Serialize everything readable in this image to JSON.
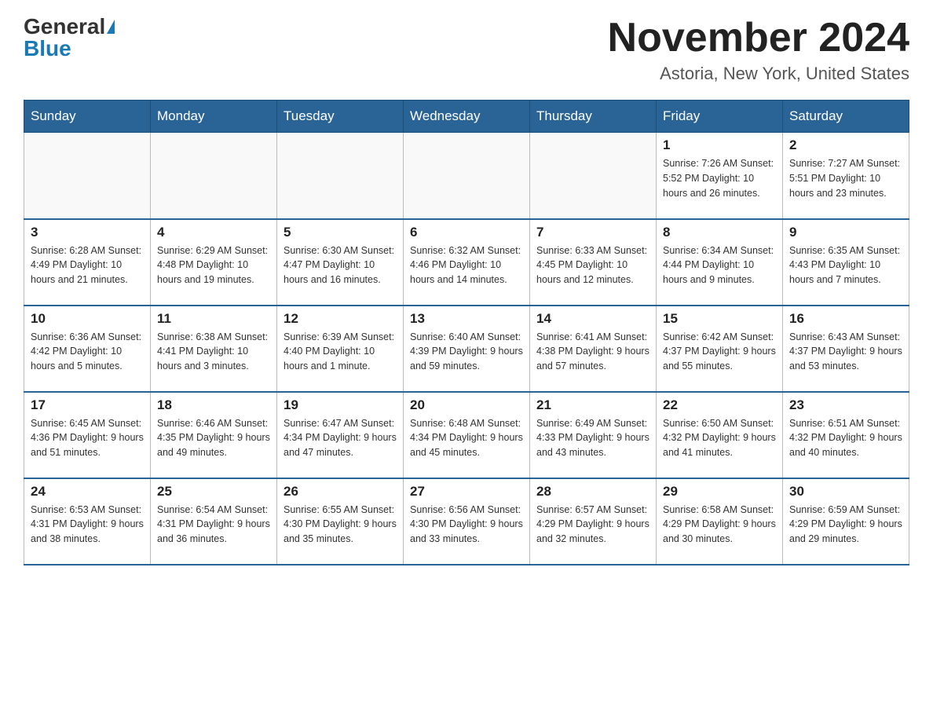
{
  "header": {
    "logo_general": "General",
    "logo_blue": "Blue",
    "main_title": "November 2024",
    "subtitle": "Astoria, New York, United States"
  },
  "days_of_week": [
    "Sunday",
    "Monday",
    "Tuesday",
    "Wednesday",
    "Thursday",
    "Friday",
    "Saturday"
  ],
  "weeks": [
    [
      {
        "day": "",
        "info": ""
      },
      {
        "day": "",
        "info": ""
      },
      {
        "day": "",
        "info": ""
      },
      {
        "day": "",
        "info": ""
      },
      {
        "day": "",
        "info": ""
      },
      {
        "day": "1",
        "info": "Sunrise: 7:26 AM\nSunset: 5:52 PM\nDaylight: 10 hours and 26 minutes."
      },
      {
        "day": "2",
        "info": "Sunrise: 7:27 AM\nSunset: 5:51 PM\nDaylight: 10 hours and 23 minutes."
      }
    ],
    [
      {
        "day": "3",
        "info": "Sunrise: 6:28 AM\nSunset: 4:49 PM\nDaylight: 10 hours and 21 minutes."
      },
      {
        "day": "4",
        "info": "Sunrise: 6:29 AM\nSunset: 4:48 PM\nDaylight: 10 hours and 19 minutes."
      },
      {
        "day": "5",
        "info": "Sunrise: 6:30 AM\nSunset: 4:47 PM\nDaylight: 10 hours and 16 minutes."
      },
      {
        "day": "6",
        "info": "Sunrise: 6:32 AM\nSunset: 4:46 PM\nDaylight: 10 hours and 14 minutes."
      },
      {
        "day": "7",
        "info": "Sunrise: 6:33 AM\nSunset: 4:45 PM\nDaylight: 10 hours and 12 minutes."
      },
      {
        "day": "8",
        "info": "Sunrise: 6:34 AM\nSunset: 4:44 PM\nDaylight: 10 hours and 9 minutes."
      },
      {
        "day": "9",
        "info": "Sunrise: 6:35 AM\nSunset: 4:43 PM\nDaylight: 10 hours and 7 minutes."
      }
    ],
    [
      {
        "day": "10",
        "info": "Sunrise: 6:36 AM\nSunset: 4:42 PM\nDaylight: 10 hours and 5 minutes."
      },
      {
        "day": "11",
        "info": "Sunrise: 6:38 AM\nSunset: 4:41 PM\nDaylight: 10 hours and 3 minutes."
      },
      {
        "day": "12",
        "info": "Sunrise: 6:39 AM\nSunset: 4:40 PM\nDaylight: 10 hours and 1 minute."
      },
      {
        "day": "13",
        "info": "Sunrise: 6:40 AM\nSunset: 4:39 PM\nDaylight: 9 hours and 59 minutes."
      },
      {
        "day": "14",
        "info": "Sunrise: 6:41 AM\nSunset: 4:38 PM\nDaylight: 9 hours and 57 minutes."
      },
      {
        "day": "15",
        "info": "Sunrise: 6:42 AM\nSunset: 4:37 PM\nDaylight: 9 hours and 55 minutes."
      },
      {
        "day": "16",
        "info": "Sunrise: 6:43 AM\nSunset: 4:37 PM\nDaylight: 9 hours and 53 minutes."
      }
    ],
    [
      {
        "day": "17",
        "info": "Sunrise: 6:45 AM\nSunset: 4:36 PM\nDaylight: 9 hours and 51 minutes."
      },
      {
        "day": "18",
        "info": "Sunrise: 6:46 AM\nSunset: 4:35 PM\nDaylight: 9 hours and 49 minutes."
      },
      {
        "day": "19",
        "info": "Sunrise: 6:47 AM\nSunset: 4:34 PM\nDaylight: 9 hours and 47 minutes."
      },
      {
        "day": "20",
        "info": "Sunrise: 6:48 AM\nSunset: 4:34 PM\nDaylight: 9 hours and 45 minutes."
      },
      {
        "day": "21",
        "info": "Sunrise: 6:49 AM\nSunset: 4:33 PM\nDaylight: 9 hours and 43 minutes."
      },
      {
        "day": "22",
        "info": "Sunrise: 6:50 AM\nSunset: 4:32 PM\nDaylight: 9 hours and 41 minutes."
      },
      {
        "day": "23",
        "info": "Sunrise: 6:51 AM\nSunset: 4:32 PM\nDaylight: 9 hours and 40 minutes."
      }
    ],
    [
      {
        "day": "24",
        "info": "Sunrise: 6:53 AM\nSunset: 4:31 PM\nDaylight: 9 hours and 38 minutes."
      },
      {
        "day": "25",
        "info": "Sunrise: 6:54 AM\nSunset: 4:31 PM\nDaylight: 9 hours and 36 minutes."
      },
      {
        "day": "26",
        "info": "Sunrise: 6:55 AM\nSunset: 4:30 PM\nDaylight: 9 hours and 35 minutes."
      },
      {
        "day": "27",
        "info": "Sunrise: 6:56 AM\nSunset: 4:30 PM\nDaylight: 9 hours and 33 minutes."
      },
      {
        "day": "28",
        "info": "Sunrise: 6:57 AM\nSunset: 4:29 PM\nDaylight: 9 hours and 32 minutes."
      },
      {
        "day": "29",
        "info": "Sunrise: 6:58 AM\nSunset: 4:29 PM\nDaylight: 9 hours and 30 minutes."
      },
      {
        "day": "30",
        "info": "Sunrise: 6:59 AM\nSunset: 4:29 PM\nDaylight: 9 hours and 29 minutes."
      }
    ]
  ]
}
